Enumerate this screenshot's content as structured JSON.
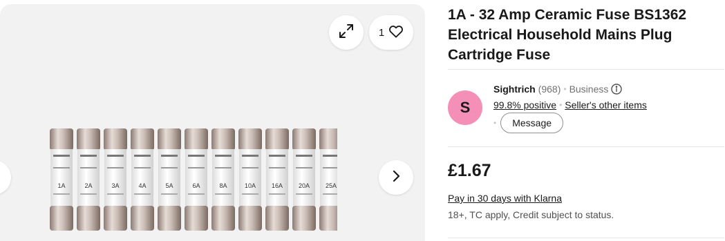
{
  "gallery": {
    "watch_count": "1",
    "fuse_labels": [
      "1A",
      "2A",
      "3A",
      "4A",
      "5A",
      "6A",
      "8A",
      "10A",
      "16A",
      "20A",
      "25A"
    ]
  },
  "listing": {
    "title": "1A - 32 Amp Ceramic Fuse BS1362 Electrical Household Mains Plug Cartridge Fuse"
  },
  "seller": {
    "avatar_letter": "S",
    "name": "Sightrich",
    "feedback_count": "(968)",
    "type": "Business",
    "positive": "99.8% positive",
    "other_items": "Seller's other items",
    "message_label": "Message"
  },
  "price": {
    "amount": "£1.67",
    "klarna": "Pay in 30 days with Klarna",
    "terms": "18+, TC apply, Credit subject to status."
  },
  "colors": {
    "avatar_bg": "#f48fb8",
    "gallery_bg": "#f2f2f2"
  }
}
